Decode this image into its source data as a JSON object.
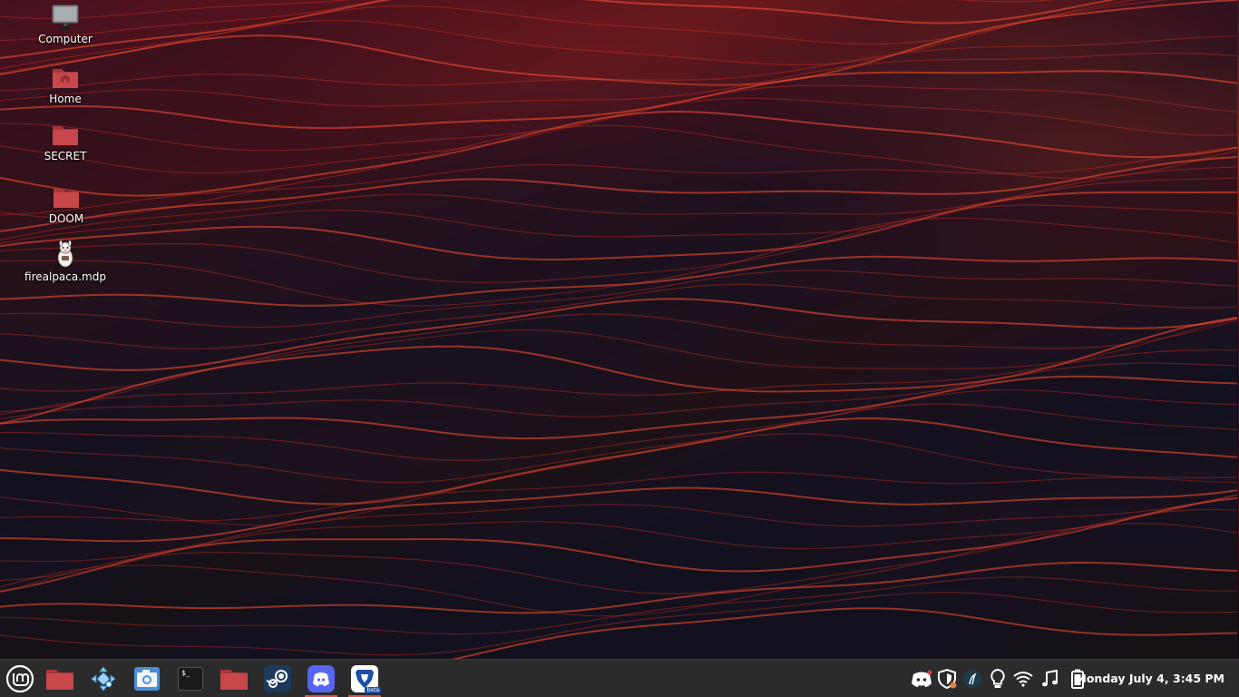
{
  "desktop": {
    "icons": [
      {
        "label": "Computer",
        "icon": "computer-icon"
      },
      {
        "label": "Home",
        "icon": "home-folder-icon"
      },
      {
        "label": "SECRET",
        "icon": "folder-icon"
      },
      {
        "label": "DOOM",
        "icon": "folder-icon"
      },
      {
        "label": "firealpaca.mdp",
        "icon": "alpaca-file-icon"
      }
    ]
  },
  "taskbar": {
    "launchers": [
      {
        "name": "mint-menu",
        "icon": "linux-mint-icon",
        "running": false
      },
      {
        "name": "files",
        "icon": "folder-icon",
        "running": false
      },
      {
        "name": "ppsspp",
        "icon": "gamepad-icon",
        "running": false
      },
      {
        "name": "screenshot",
        "icon": "camera-icon",
        "running": false
      },
      {
        "name": "terminal",
        "icon": "terminal-icon",
        "running": false
      },
      {
        "name": "files-2",
        "icon": "folder-icon",
        "running": false
      },
      {
        "name": "steam",
        "icon": "steam-icon",
        "running": false
      },
      {
        "name": "discord",
        "icon": "discord-icon",
        "running": true
      },
      {
        "name": "brave-beta",
        "icon": "brave-beta-icon",
        "running": true
      }
    ],
    "brave_badge": "beta",
    "terminal_prompt": "$_",
    "tray": [
      "discord-tray-icon",
      "security-shield-icon",
      "pen-tablet-icon",
      "lightbulb-icon",
      "wifi-icon",
      "music-note-icon",
      "battery-icon"
    ],
    "clock": "Monday July  4,  3:45 PM"
  },
  "colors": {
    "taskbar_bg": "#2b2b2b",
    "folder_red": "#c8474b",
    "running_indicator": "#d9534f",
    "discord_blue": "#5865f2",
    "mint_green": "#ffffff"
  }
}
